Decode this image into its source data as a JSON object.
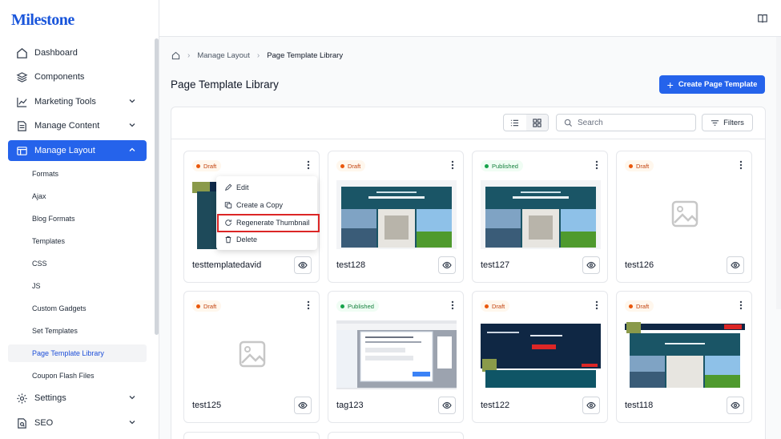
{
  "app": {
    "logo": "Milestone"
  },
  "sidebar": {
    "items": [
      {
        "label": "Dashboard",
        "icon": "home-icon"
      },
      {
        "label": "Components",
        "icon": "layers-icon"
      },
      {
        "label": "Marketing Tools",
        "icon": "chart-line-icon"
      },
      {
        "label": "Manage Content",
        "icon": "document-icon"
      },
      {
        "label": "Manage Layout",
        "icon": "layout-icon"
      }
    ],
    "sub_items": [
      "Formats",
      "Ajax",
      "Blog Formats",
      "Templates",
      "CSS",
      "JS",
      "Custom Gadgets",
      "Set Templates",
      "Page Template Library",
      "Coupon Flash Files"
    ],
    "bottom_items": [
      {
        "label": "Settings",
        "icon": "gear-icon"
      },
      {
        "label": "SEO",
        "icon": "seo-icon"
      }
    ]
  },
  "breadcrumb": {
    "home_icon": "home-icon",
    "level1": "Manage Layout",
    "level2": "Page Template Library",
    "sep": "›"
  },
  "page": {
    "title": "Page Template Library",
    "create_label": "Create Page Template"
  },
  "toolbar": {
    "search_placeholder": "Search",
    "filters_label": "Filters"
  },
  "cards": [
    {
      "name": "testtemplatedavid",
      "status": "Draft"
    },
    {
      "name": "test128",
      "status": "Draft"
    },
    {
      "name": "test127",
      "status": "Published"
    },
    {
      "name": "test126",
      "status": "Draft"
    },
    {
      "name": "test125",
      "status": "Draft"
    },
    {
      "name": "tag123",
      "status": "Published"
    },
    {
      "name": "test122",
      "status": "Draft"
    },
    {
      "name": "test118",
      "status": "Draft"
    }
  ],
  "thumb_text": {
    "line1": "Title will goes here",
    "line2": "LOREM IPSUM"
  },
  "context_menu": [
    "Edit",
    "Create a Copy",
    "Regenerate Thumbnail",
    "Delete"
  ],
  "colors": {
    "accent": "#2563eb",
    "draft": "#ea580c",
    "published": "#16a34a",
    "highlight": "#dc2626"
  }
}
